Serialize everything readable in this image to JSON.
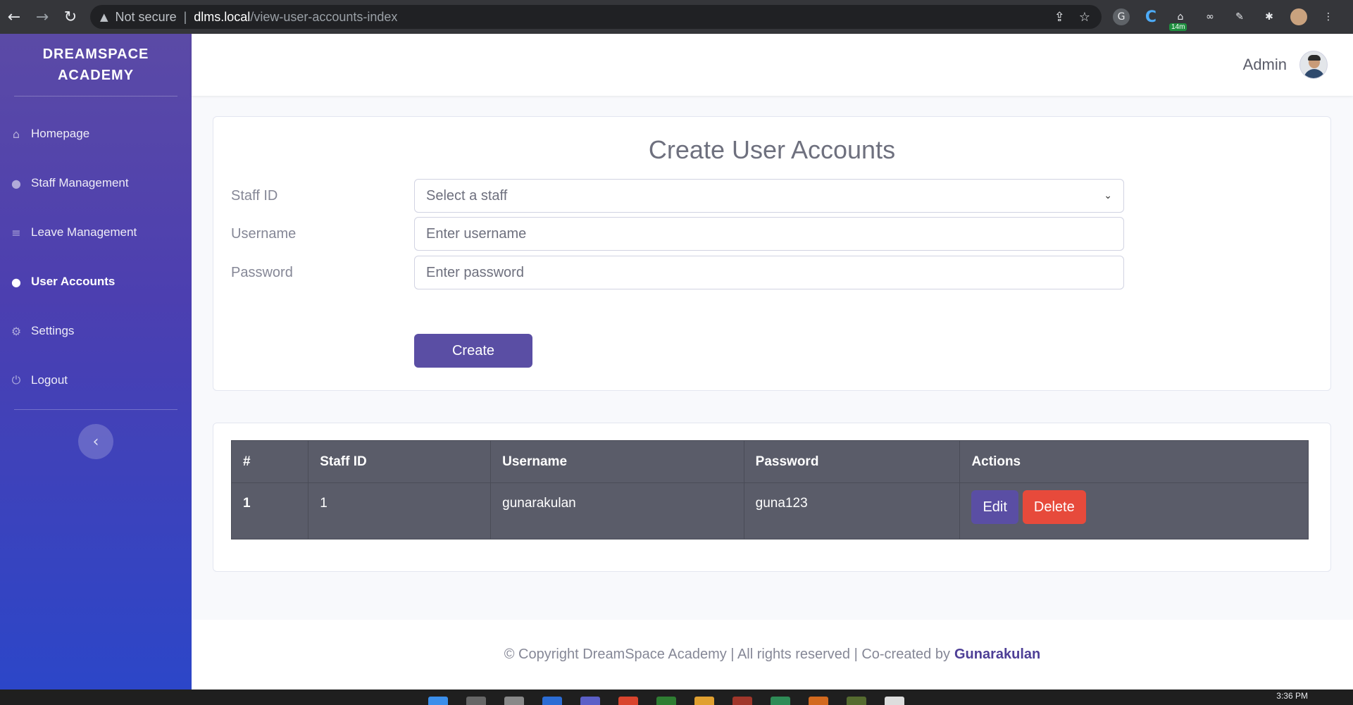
{
  "browser": {
    "security_label": "Not secure",
    "url_host": "dlms.local",
    "url_path": "/view-user-accounts-index",
    "ext_badge": "14m"
  },
  "sidebar": {
    "brand_line1": "DREAMSPACE",
    "brand_line2": "ACADEMY",
    "items": [
      {
        "label": "Homepage",
        "icon": "home-icon"
      },
      {
        "label": "Staff Management",
        "icon": "users-icon"
      },
      {
        "label": "Leave Management",
        "icon": "database-icon"
      },
      {
        "label": "User Accounts",
        "icon": "user-icon",
        "active": true
      },
      {
        "label": "Settings",
        "icon": "gear-icon"
      },
      {
        "label": "Logout",
        "icon": "power-icon"
      }
    ]
  },
  "topbar": {
    "user_name": "Admin"
  },
  "form": {
    "title": "Create User Accounts",
    "staff_label": "Staff ID",
    "staff_select_value": "Select a staff",
    "username_label": "Username",
    "username_placeholder": "Enter username",
    "password_label": "Password",
    "password_placeholder": "Enter password",
    "submit_label": "Create"
  },
  "table": {
    "headers": [
      "#",
      "Staff ID",
      "Username",
      "Password",
      "Actions"
    ],
    "rows": [
      {
        "index": "1",
        "staff_id": "1",
        "username": "gunarakulan",
        "password": "guna123",
        "edit_label": "Edit",
        "delete_label": "Delete"
      }
    ]
  },
  "footer": {
    "text": "© Copyright DreamSpace Academy | All rights reserved | Co-created by",
    "author": "Gunarakulan"
  },
  "taskbar": {
    "time": "3:36 PM"
  },
  "colors": {
    "primary": "#5a4ea4",
    "danger": "#e74a3b",
    "table_bg": "#5a5c69",
    "sidebar_top": "#5b4aa6",
    "sidebar_bottom": "#2c46c8"
  }
}
